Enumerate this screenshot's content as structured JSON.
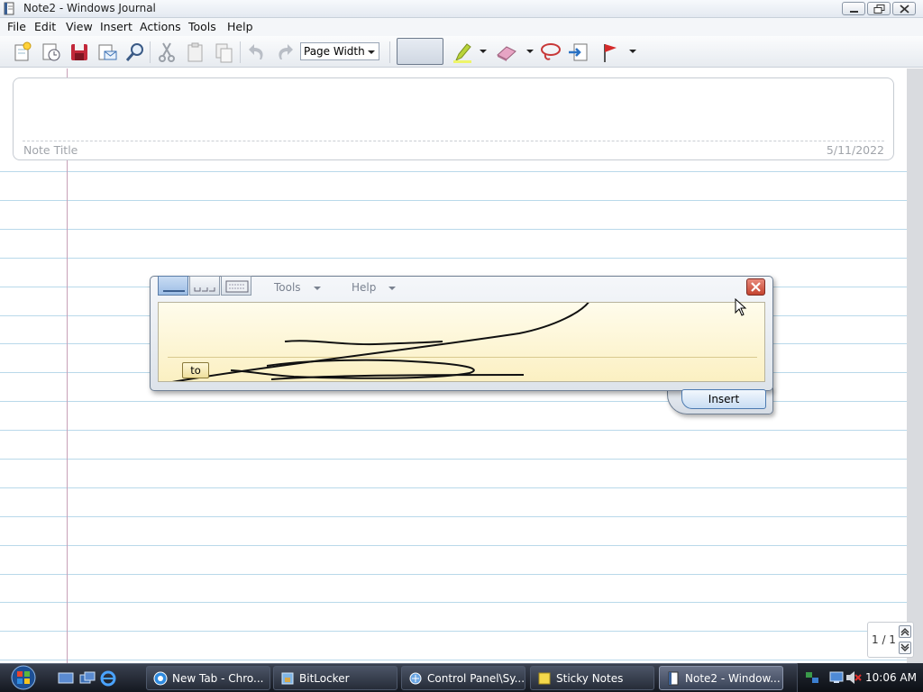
{
  "window": {
    "title": "Note2 - Windows Journal"
  },
  "menu": [
    "File",
    "Edit",
    "View",
    "Insert",
    "Actions",
    "Tools",
    "Help"
  ],
  "toolbar": {
    "zoom_value": "Page Width",
    "icons": [
      "new-note-icon",
      "new-from-template-icon",
      "save-icon",
      "send-email-icon",
      "find-icon",
      "cut-icon",
      "copy-icon",
      "paste-icon",
      "undo-icon",
      "redo-icon",
      "pen-icon",
      "highlighter-icon",
      "eraser-icon",
      "selection-lasso-icon",
      "insert-space-icon",
      "flag-icon"
    ]
  },
  "note": {
    "title_placeholder": "Note Title",
    "date": "5/11/2022"
  },
  "page_nav": {
    "label": "1 / 1"
  },
  "input_panel": {
    "tools_label": "Tools",
    "help_label": "Help",
    "suggestion": "to",
    "insert_label": "Insert"
  },
  "taskbar": {
    "tasks": [
      {
        "label": "New Tab - Chro...",
        "icon": "chrome-icon"
      },
      {
        "label": "BitLocker",
        "icon": "bitlocker-icon"
      },
      {
        "label": "Control Panel\\Sy...",
        "icon": "control-panel-icon"
      },
      {
        "label": "Sticky Notes",
        "icon": "sticky-notes-icon"
      },
      {
        "label": "Note2 - Window...",
        "icon": "journal-icon"
      }
    ],
    "clock": "10:06 AM"
  },
  "colors": {
    "rule_line": "#b9d9ea",
    "margin_line": "#c7a0b8",
    "pad_background": "#fbf0c2",
    "taskbar": "#1e232d"
  }
}
